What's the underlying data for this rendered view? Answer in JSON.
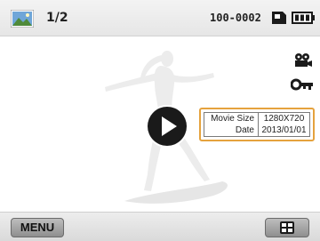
{
  "topbar": {
    "counter": "1/2",
    "file_number": "100-0002",
    "thumb_icon": "thumbnail-icon",
    "card_icon": "memory-card-icon",
    "battery_icon": "battery-full-icon"
  },
  "status_icons": [
    "movie-camera-icon",
    "protect-key-icon"
  ],
  "info": {
    "rows": [
      {
        "label": "Movie Size",
        "value": "1280X720"
      },
      {
        "label": "Date",
        "value": "2013/01/01"
      }
    ]
  },
  "bottombar": {
    "menu_label": "MENU",
    "view_icon": "view-mode-icon"
  },
  "colors": {
    "accent_border": "#e5a23d",
    "bar_bg": "#e6e6e6"
  }
}
